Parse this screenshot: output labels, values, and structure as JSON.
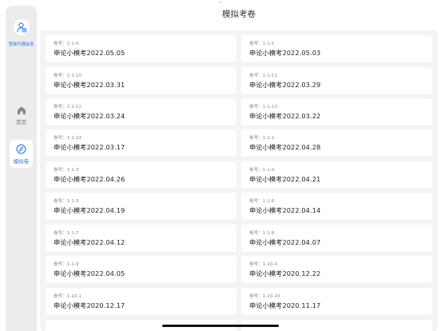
{
  "sidebar": {
    "login_text": "登录开通会员",
    "items": [
      {
        "label": "首页",
        "icon": "home-icon"
      },
      {
        "label": "模拟卷",
        "icon": "compass-icon"
      }
    ],
    "accent_color": "#2f7ae5"
  },
  "header": {
    "title": "模拟考卷"
  },
  "papers": [
    {
      "code": "卷号：1-1-0",
      "name": "申论小模考2022.05.05"
    },
    {
      "code": "卷号：1-1-1",
      "name": "申论小模考2022.05.03"
    },
    {
      "code": "卷号：1-1-10",
      "name": "申论小模考2022.03.31"
    },
    {
      "code": "卷号：1-1-11",
      "name": "申论小模考2022.03.29"
    },
    {
      "code": "卷号：1-1-12",
      "name": "申论小模考2022.03.24"
    },
    {
      "code": "卷号：1-1-13",
      "name": "申论小模考2022.03.22"
    },
    {
      "code": "卷号：1-1-14",
      "name": "申论小模考2022.03.17"
    },
    {
      "code": "卷号：1-1-2",
      "name": "申论小模考2022.04.28"
    },
    {
      "code": "卷号：1-1-3",
      "name": "申论小模考2022.04.26"
    },
    {
      "code": "卷号：1-1-4",
      "name": "申论小模考2022.04.21"
    },
    {
      "code": "卷号：1-1-5",
      "name": "申论小模考2022.04.19"
    },
    {
      "code": "卷号：1-1-6",
      "name": "申论小模考2022.04.14"
    },
    {
      "code": "卷号：1-1-7",
      "name": "申论小模考2022.04.12"
    },
    {
      "code": "卷号：1-1-8",
      "name": "申论小模考2022.04.07"
    },
    {
      "code": "卷号：1-1-9",
      "name": "申论小模考2022.04.05"
    },
    {
      "code": "卷号：1-10-0",
      "name": "申论小模考2020.12.22"
    },
    {
      "code": "卷号：1-10-1",
      "name": "申论小模考2020.12.17"
    },
    {
      "code": "卷号：1-10-10",
      "name": "申论小模考2020.11.17"
    }
  ]
}
